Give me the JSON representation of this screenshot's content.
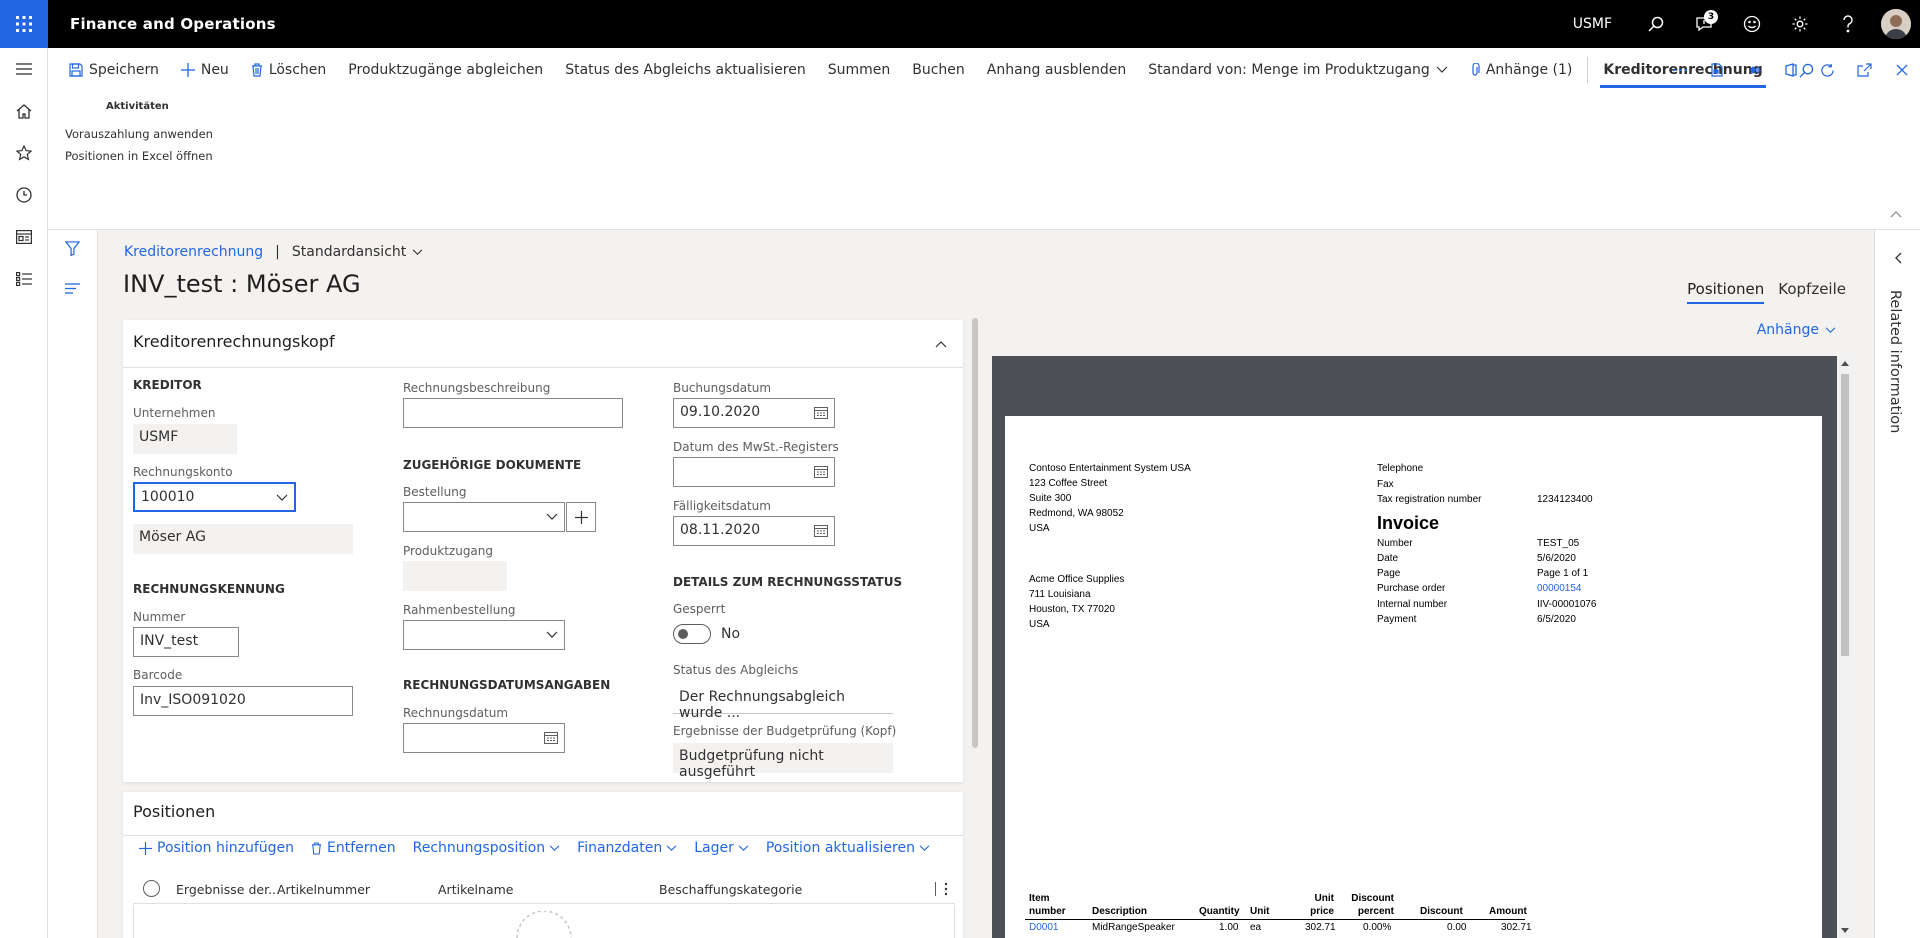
{
  "topbar": {
    "app_title": "Finance and Operations",
    "company": "USMF",
    "notification_count": "3"
  },
  "action_pane": {
    "buttons": [
      {
        "label": "Speichern",
        "icon": "save-icon"
      },
      {
        "label": "Neu",
        "icon": "plus-icon"
      },
      {
        "label": "Löschen",
        "icon": "trash-icon"
      },
      {
        "label": "Produktzugänge abgleichen"
      },
      {
        "label": "Status des Abgleichs aktualisieren"
      },
      {
        "label": "Summen"
      },
      {
        "label": "Buchen"
      },
      {
        "label": "Anhang ausblenden"
      },
      {
        "label": "Standard von: Menge im Produktzugang"
      },
      {
        "label": "Anhänge (1)",
        "icon": "paperclip-icon"
      },
      {
        "label": "Kreditorenrechnung",
        "active": true
      }
    ],
    "group_header": "Aktivitäten",
    "group_items": [
      "Vorauszahlung anwenden",
      "Positionen in Excel öffnen"
    ]
  },
  "breadcrumb": {
    "link": "Kreditorenrechnung",
    "view": "Standardansicht"
  },
  "page_title": "INV_test : Möser AG",
  "view_tabs": [
    {
      "label": "Positionen",
      "selected": true
    },
    {
      "label": "Kopfzeile",
      "selected": false
    }
  ],
  "attachments_link": "Anhänge",
  "related_info": "Related information",
  "header_card": {
    "title": "Kreditorenrechnungskopf",
    "kreditor": {
      "section": "KREDITOR",
      "unternehmen_label": "Unternehmen",
      "unternehmen_value": "USMF",
      "rechnungskonto_label": "Rechnungskonto",
      "rechnungskonto_value": "100010",
      "name_value": "Möser AG"
    },
    "rechnungskennung": {
      "section": "RECHNUNGSKENNUNG",
      "nummer_label": "Nummer",
      "nummer_value": "INV_test",
      "barcode_label": "Barcode",
      "barcode_value": "Inv_ISO091020"
    },
    "col2": {
      "beschreibung_label": "Rechnungsbeschreibung",
      "beschreibung_value": "",
      "docs_section": "ZUGEHÖRIGE DOKUMENTE",
      "bestellung_label": "Bestellung",
      "produktzugang_label": "Produktzugang",
      "rahmenbestellung_label": "Rahmenbestellung",
      "datum_section": "RECHNUNGSDATUMSANGABEN",
      "rechnungsdatum_label": "Rechnungsdatum"
    },
    "col3": {
      "buchungsdatum_label": "Buchungsdatum",
      "buchungsdatum_value": "09.10.2020",
      "mwst_label": "Datum des MwSt.-Registers",
      "faellig_label": "Fälligkeitsdatum",
      "faellig_value": "08.11.2020",
      "status_section": "DETAILS ZUM RECHNUNGSSTATUS",
      "gesperrt_label": "Gesperrt",
      "gesperrt_value": "No",
      "abgleich_label": "Status des Abgleichs",
      "abgleich_value": "Der Rechnungsabgleich wurde ...",
      "budget_label": "Ergebnisse der Budgetprüfung (Kopf)",
      "budget_value": "Budgetprüfung nicht ausgeführt"
    }
  },
  "lines_card": {
    "title": "Positionen",
    "toolbar": [
      "Position hinzufügen",
      "Entfernen",
      "Rechnungsposition",
      "Finanzdaten",
      "Lager",
      "Position aktualisieren"
    ],
    "columns": [
      "Ergebnisse der...",
      "Artikelnummer",
      "Artikelname",
      "Beschaffungskategorie"
    ]
  },
  "invoice_doc": {
    "from": [
      "Contoso Entertainment System USA",
      "123 Coffee Street",
      "Suite 300",
      "Redmond, WA 98052",
      "USA"
    ],
    "to": [
      "Acme Office Supplies",
      "711 Louisiana",
      "Houston, TX 77020",
      "USA"
    ],
    "contact_labels": [
      "Telephone",
      "Fax",
      "Tax registration number"
    ],
    "tax_number": "1234123400",
    "heading": "Invoice",
    "fields": [
      {
        "label": "Number",
        "value": "TEST_05"
      },
      {
        "label": "Date",
        "value": "5/6/2020"
      },
      {
        "label": "Page",
        "value": "Page 1 of 1"
      },
      {
        "label": "Purchase order",
        "value": "00000154"
      },
      {
        "label": "Internal number",
        "value": "IIV-00001076"
      },
      {
        "label": "Payment",
        "value": "6/5/2020"
      }
    ],
    "table_headers": [
      "Item number",
      "Description",
      "Quantity",
      "Unit",
      "Unit price",
      "Discount percent",
      "Discount",
      "Amount"
    ],
    "row": {
      "item": "D0001",
      "description": "MidRangeSpeaker",
      "quantity": "1.00",
      "unit": "ea",
      "price": "302.71",
      "discount_percent": "0.00%",
      "discount": "0.00",
      "amount": "302.71"
    }
  }
}
